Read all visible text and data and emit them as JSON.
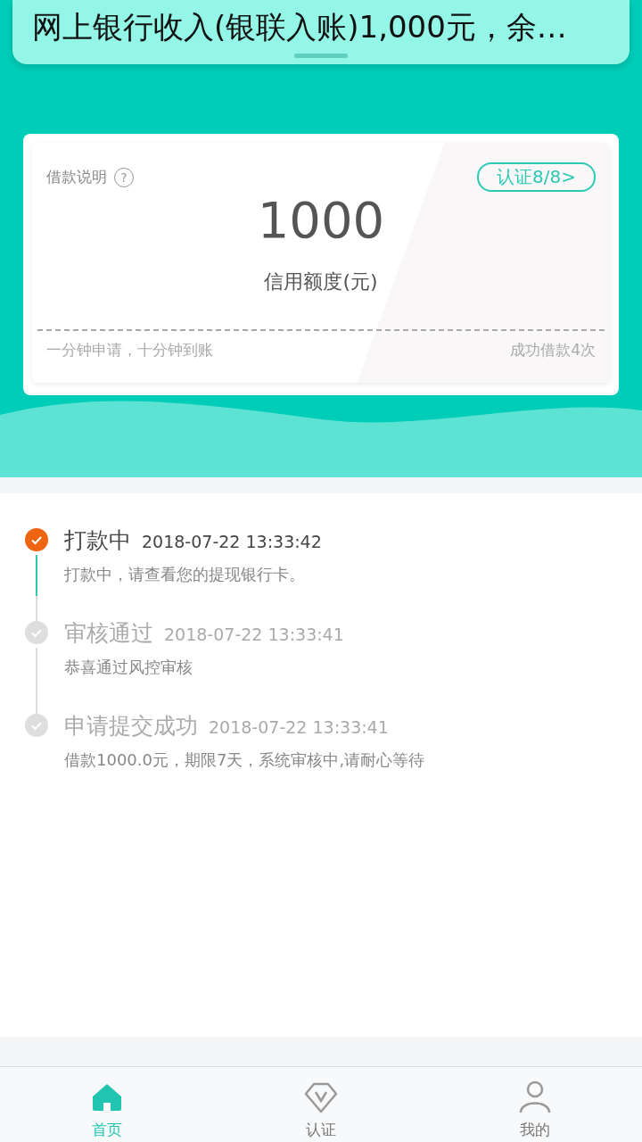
{
  "notification": {
    "text": "网上银行收入(银联入账)1,000元，余…"
  },
  "card": {
    "help_label": "借款说明",
    "help_icon": "?",
    "verify_badge": "认证8/8>",
    "amount": "1000",
    "amount_label": "信用额度(元)",
    "slogan": "一分钟申请，十分钟到账",
    "loan_count": "成功借款4次"
  },
  "timeline": [
    {
      "title": "打款中",
      "time": "2018-07-22 13:33:42",
      "detail": "打款中，请查看您的提现银行卡。",
      "active": true
    },
    {
      "title": "审核通过",
      "time": "2018-07-22 13:33:41",
      "detail": "恭喜通过风控审核",
      "active": false
    },
    {
      "title": "申请提交成功",
      "time": "2018-07-22 13:33:41",
      "detail": "借款1000.0元，期限7天，系统审核中,请耐心等待",
      "active": false
    }
  ],
  "tab_bar": [
    {
      "label": "首页",
      "kind": "home",
      "selected": true
    },
    {
      "label": "认证",
      "kind": "badge",
      "selected": false
    },
    {
      "label": "我的",
      "kind": "person",
      "selected": false
    }
  ]
}
